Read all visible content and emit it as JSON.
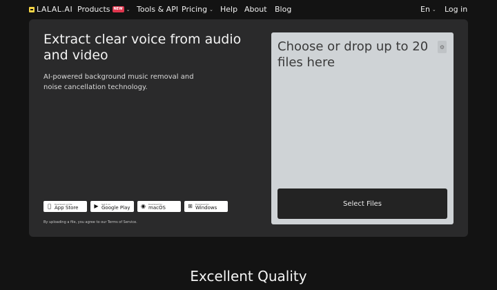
{
  "nav": {
    "logo": "LALAL.AI",
    "products": "Products",
    "products_badge": "NEW",
    "tools": "Tools & API",
    "pricing": "Pricing",
    "help": "Help",
    "about": "About",
    "blog": "Blog",
    "language": "En",
    "login": "Log in"
  },
  "hero": {
    "title": "Extract clear voice from audio and video",
    "subtitle": "AI-powered background music removal and noise cancellation technology.",
    "terms": "By uploading a file, you agree to our Terms of Service."
  },
  "stores": [
    {
      "small": "Download on the",
      "big": "App Store",
      "icon": "apple-icon"
    },
    {
      "small": "Get it on",
      "big": "Google Play",
      "icon": "google-play-icon"
    },
    {
      "small": "Download for",
      "big": "macOS",
      "icon": "macos-icon"
    },
    {
      "small": "Download for",
      "big": "Windows",
      "icon": "windows-icon"
    }
  ],
  "upload": {
    "title": "Choose or drop up to 20 files here",
    "select_label": "Select Files"
  },
  "sections": {
    "quality_title": "Excellent Quality"
  },
  "colors": {
    "background": "#131313",
    "card": "#2a2a2b",
    "drop_zone": "#cfd3d6",
    "logo_accent": "#f6d545",
    "badge": "#e0364e"
  }
}
